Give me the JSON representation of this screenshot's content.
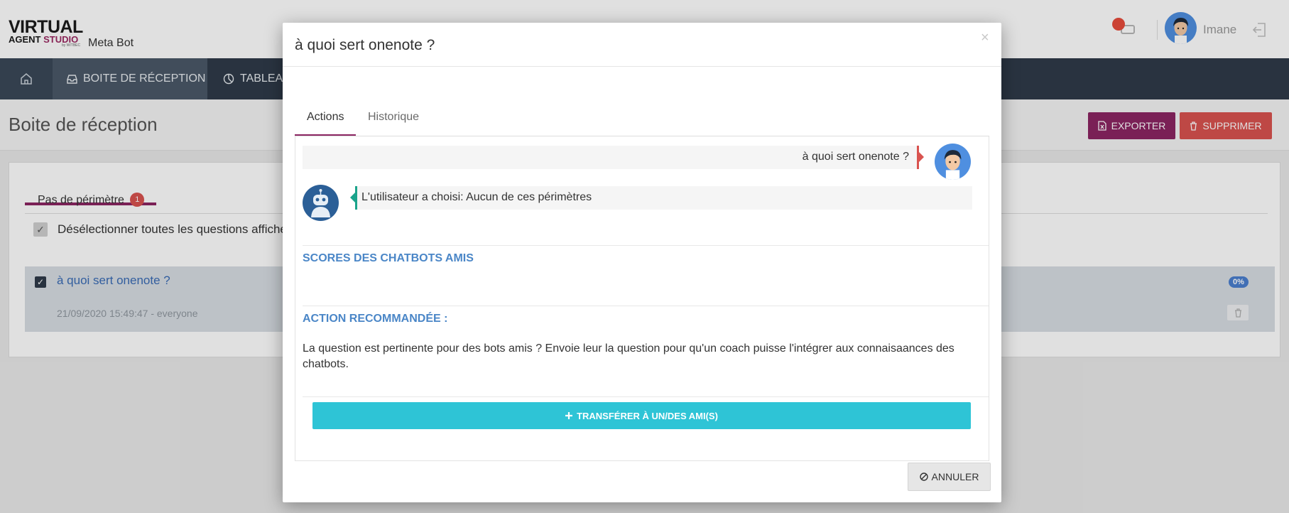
{
  "app": {
    "logo_line1": "VIRTUAL",
    "logo_agent": "AGENT",
    "logo_studio": "STUDIO",
    "logo_by": "by WITBEC",
    "bot_name": "Meta Bot"
  },
  "header": {
    "user_name": "Imane"
  },
  "nav": {
    "inbox_label": "BOITE DE RÉCEPTION",
    "dashboard_label": "TABLEAU"
  },
  "page": {
    "title": "Boite de réception",
    "export_label": "EXPORTER",
    "delete_label": "SUPPRIMER"
  },
  "inbox": {
    "tab_label": "Pas de périmètre",
    "tab_badge": "1",
    "deselect_label": "Désélectionner toutes les questions affiché",
    "question": {
      "text": "à quoi sert onenote ?",
      "meta": "21/09/2020 15:49:47 - everyone",
      "score": "0%"
    }
  },
  "modal": {
    "title": "à quoi sert onenote ?",
    "close": "×",
    "tabs": [
      "Actions",
      "Historique"
    ],
    "user_message": "à quoi sert onenote ?",
    "bot_message": "L'utilisateur a choisi: Aucun de ces périmètres",
    "scores_title": "SCORES DES CHATBOTS AMIS",
    "action_title": "ACTION RECOMMANDÉE :",
    "action_text": "La question est pertinente pour des bots amis ? Envoie leur la question pour qu'un coach puisse l'intégrer aux connaisaances des chatbots.",
    "transfer_label": "TRANSFÉRER À UN/DES AMI(S)",
    "cancel_label": "ANNULER"
  },
  "colors": {
    "brand": "#8b2562",
    "danger": "#d9534f",
    "accent": "#2ec4d6",
    "link": "#4a86c7",
    "nav_bg": "#2f3b49"
  }
}
